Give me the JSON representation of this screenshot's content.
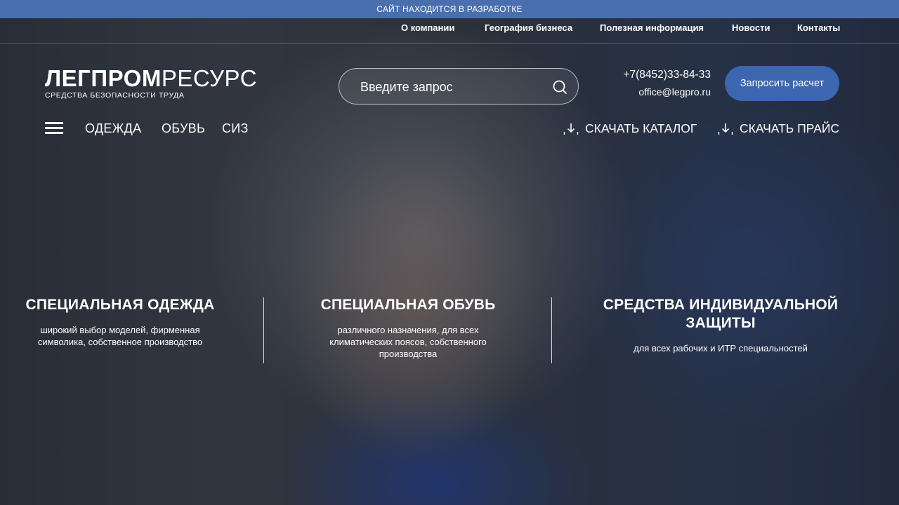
{
  "banner": {
    "text": "САЙТ НАХОДИТСЯ В РАЗРАБОТКЕ"
  },
  "top_nav": {
    "items": [
      "О компании",
      "География бизнеса",
      "Полезная информация",
      "Новости",
      "Контакты"
    ]
  },
  "logo": {
    "part1": "ЛЕГПРОМ",
    "part2": "РЕСУРС",
    "tagline": "СРЕДСТВА БЕЗОПАСНОСТИ ТРУДА"
  },
  "search": {
    "placeholder": "Введите запрос",
    "icon": "search-icon"
  },
  "contacts": {
    "phone": "+7(8452)33-84-33",
    "email": "office@legpro.ru"
  },
  "cta": {
    "label": "Запросить расчет"
  },
  "main_nav": {
    "menu_icon": "hamburger-menu-icon",
    "items": [
      "ОДЕЖДА",
      "ОБУВЬ",
      "СИЗ"
    ]
  },
  "downloads": {
    "catalog": "СКАЧАТЬ КАТАЛОГ",
    "price": "СКАЧАТЬ ПРАЙС",
    "icon": "download-icon"
  },
  "features": [
    {
      "title": "СПЕЦИАЛЬНАЯ ОДЕЖДА",
      "line1": "широкий выбор моделей, фирменная",
      "line2": "символика, собственное производство",
      "line3": ""
    },
    {
      "title": "СПЕЦИАЛЬНАЯ ОБУВЬ",
      "line1": "различного назначения, для всех",
      "line2": "климатических поясов, собственного",
      "line3": "производства"
    },
    {
      "title_line1": "СРЕДСТВА ИНДИВИДУАЛЬНОЙ",
      "title_line2": "ЗАЩИТЫ",
      "line1": "для всех рабочих и ИТР специальностей"
    }
  ],
  "colors": {
    "banner": "#4a6fae",
    "cta": "#3d66b0",
    "text": "#ffffff"
  }
}
